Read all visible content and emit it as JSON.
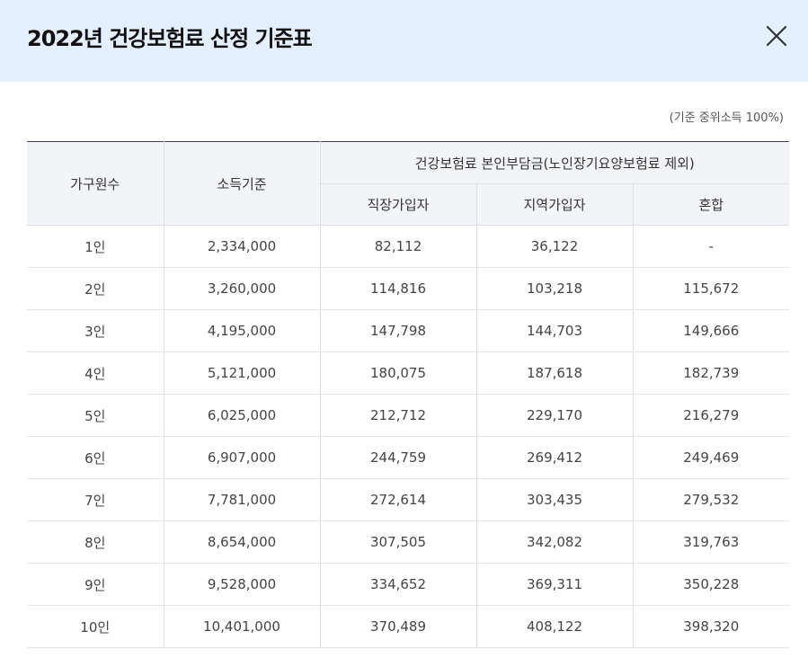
{
  "modal": {
    "title": "2022년 건강보험료 산정 기준표",
    "close_icon": "close-icon",
    "basis_note": "(기준 중위소득 100%)"
  },
  "table": {
    "headers": {
      "household": "가구원수",
      "income": "소득기준",
      "premium_group": "건강보험료 본인부담금(노인장기요양보험료 제외)",
      "employee": "직장가입자",
      "regional": "지역가입자",
      "mixed": "혼합"
    },
    "rows": [
      {
        "household": "1인",
        "income": "2,334,000",
        "employee": "82,112",
        "regional": "36,122",
        "mixed": "-"
      },
      {
        "household": "2인",
        "income": "3,260,000",
        "employee": "114,816",
        "regional": "103,218",
        "mixed": "115,672"
      },
      {
        "household": "3인",
        "income": "4,195,000",
        "employee": "147,798",
        "regional": "144,703",
        "mixed": "149,666"
      },
      {
        "household": "4인",
        "income": "5,121,000",
        "employee": "180,075",
        "regional": "187,618",
        "mixed": "182,739"
      },
      {
        "household": "5인",
        "income": "6,025,000",
        "employee": "212,712",
        "regional": "229,170",
        "mixed": "216,279"
      },
      {
        "household": "6인",
        "income": "6,907,000",
        "employee": "244,759",
        "regional": "269,412",
        "mixed": "249,469"
      },
      {
        "household": "7인",
        "income": "7,781,000",
        "employee": "272,614",
        "regional": "303,435",
        "mixed": "279,532"
      },
      {
        "household": "8인",
        "income": "8,654,000",
        "employee": "307,505",
        "regional": "342,082",
        "mixed": "319,763"
      },
      {
        "household": "9인",
        "income": "9,528,000",
        "employee": "334,652",
        "regional": "369,311",
        "mixed": "350,228"
      },
      {
        "household": "10인",
        "income": "10,401,000",
        "employee": "370,489",
        "regional": "408,122",
        "mixed": "398,320"
      }
    ]
  }
}
